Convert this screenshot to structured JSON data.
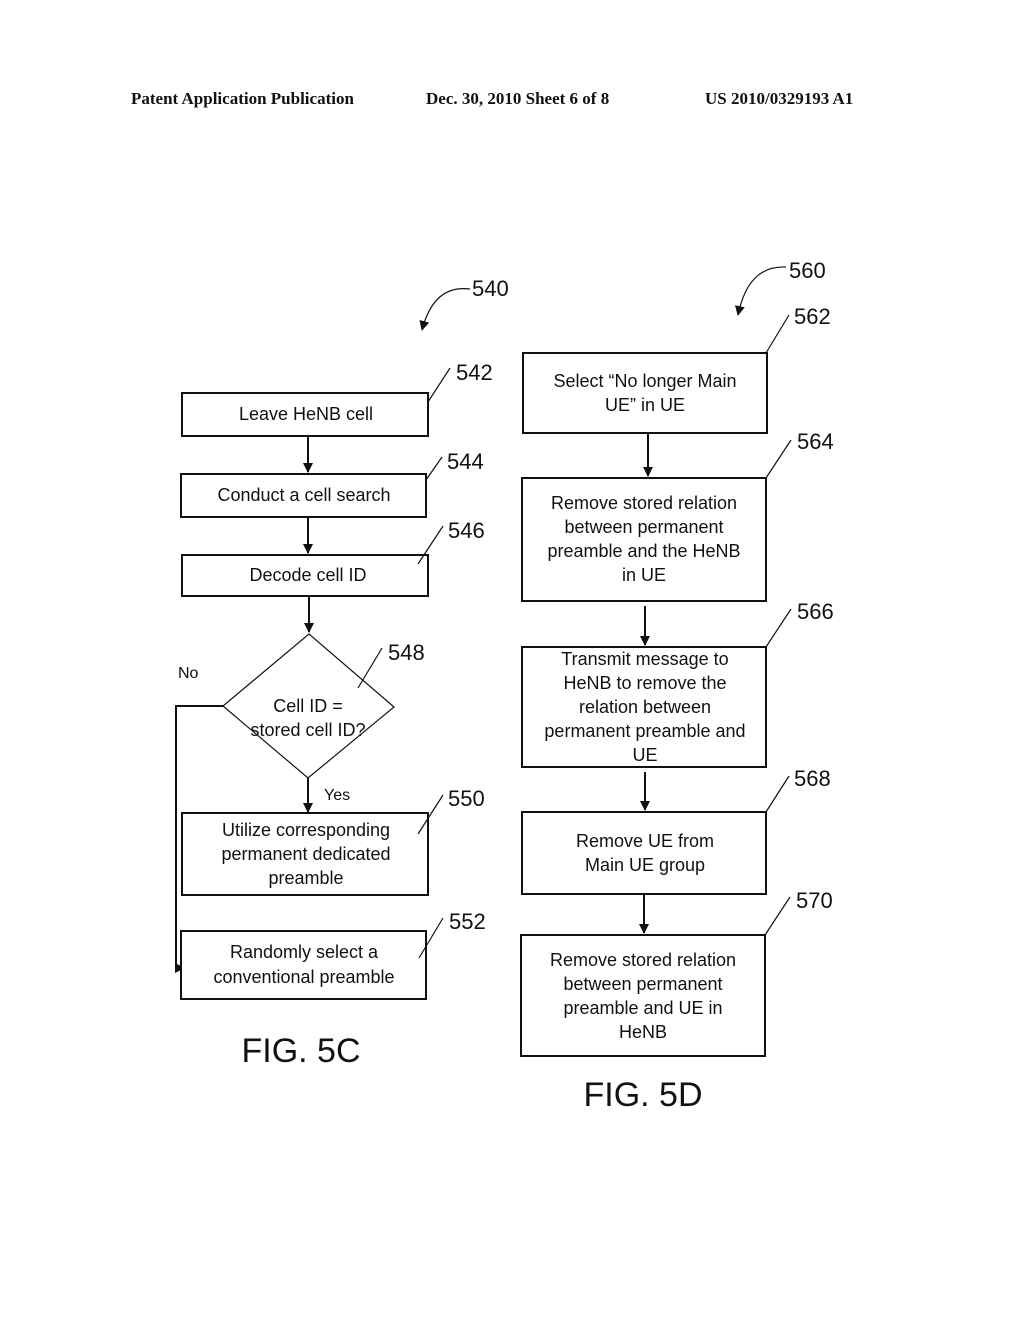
{
  "header": {
    "left": "Patent Application Publication",
    "middle": "Dec. 30, 2010   Sheet 6 of 8",
    "right": "US 2010/0329193 A1"
  },
  "fig5c": {
    "ref": "540",
    "caption": "FIG. 5C",
    "steps": [
      {
        "ref": "542",
        "lines": [
          "Leave HeNB cell"
        ]
      },
      {
        "ref": "544",
        "lines": [
          "Conduct a cell search"
        ]
      },
      {
        "ref": "546",
        "lines": [
          "Decode cell ID"
        ]
      },
      {
        "ref": "548",
        "lines": [
          "Cell ID =",
          "stored cell ID?"
        ]
      },
      {
        "ref": "550",
        "lines": [
          "Utilize corresponding",
          "permanent dedicated",
          "preamble"
        ]
      },
      {
        "ref": "552",
        "lines": [
          "Randomly select a",
          "conventional preamble"
        ]
      }
    ],
    "yes_label": "Yes",
    "no_label": "No"
  },
  "fig5d": {
    "ref": "560",
    "caption": "FIG. 5D",
    "steps": [
      {
        "ref": "562",
        "lines": [
          "Select “No longer Main",
          "UE” in UE"
        ]
      },
      {
        "ref": "564",
        "lines": [
          "Remove stored relation",
          "between permanent",
          "preamble and the HeNB",
          "in UE"
        ]
      },
      {
        "ref": "566",
        "lines": [
          "Transmit message to",
          "HeNB to remove the",
          "relation between",
          "permanent preamble and",
          "UE"
        ]
      },
      {
        "ref": "568",
        "lines": [
          "Remove UE from",
          "Main UE group"
        ]
      },
      {
        "ref": "570",
        "lines": [
          "Remove stored relation",
          "between permanent",
          "preamble and UE in",
          "HeNB"
        ]
      }
    ]
  }
}
